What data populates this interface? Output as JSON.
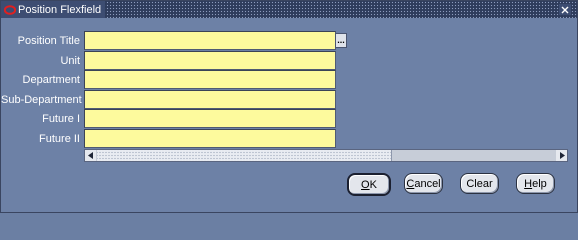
{
  "window": {
    "title": "Position Flexfield",
    "close_icon": "close-x"
  },
  "fields": [
    {
      "label": "Position Title",
      "value": ""
    },
    {
      "label": "Unit",
      "value": ""
    },
    {
      "label": "Department",
      "value": ""
    },
    {
      "label": "Sub-Department",
      "value": ""
    },
    {
      "label": "Future I",
      "value": ""
    },
    {
      "label": "Future II",
      "value": ""
    }
  ],
  "lov_button": {
    "label": "..."
  },
  "buttons": {
    "ok": {
      "mnemonic": "O",
      "rest": "K"
    },
    "cancel": {
      "mnemonic": "C",
      "rest": "ancel"
    },
    "clear": {
      "label": "Clear"
    },
    "help": {
      "mnemonic": "H",
      "rest": "elp"
    }
  },
  "colors": {
    "field_background": "#fdfa9d",
    "window_background": "#6d81a6",
    "oracle_icon": "#d11f1f"
  }
}
